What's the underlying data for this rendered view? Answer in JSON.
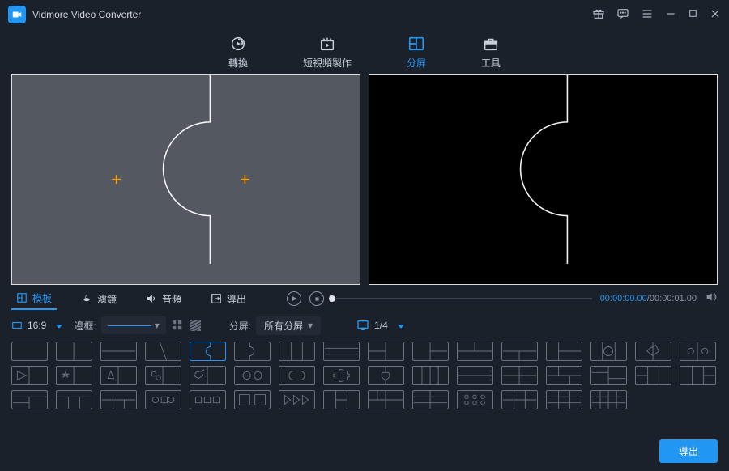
{
  "app": {
    "title": "Vidmore Video Converter"
  },
  "topnav": [
    {
      "label": "轉換"
    },
    {
      "label": "短視頻製作"
    },
    {
      "label": "分屏",
      "active": true
    },
    {
      "label": "工具"
    }
  ],
  "bottom_tabs": [
    {
      "label": "模板",
      "active": true
    },
    {
      "label": "濾鏡"
    },
    {
      "label": "音頻"
    },
    {
      "label": "導出"
    }
  ],
  "player": {
    "current": "00:00:00.00",
    "duration": "00:00:01.00"
  },
  "options": {
    "aspect_label": "16:9",
    "border_label": "邊框:",
    "split_label": "分屏:",
    "split_value": "所有分屏",
    "screen_count": "1/4"
  },
  "footer": {
    "export": "導出"
  }
}
